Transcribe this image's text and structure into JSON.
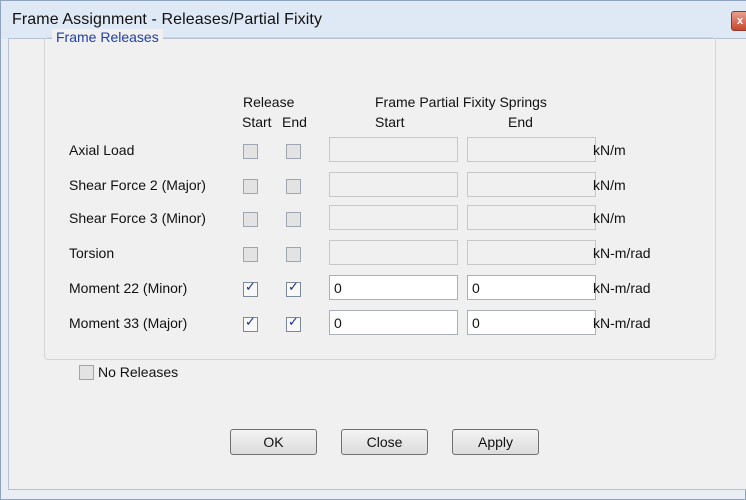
{
  "window": {
    "title": "Frame Assignment - Releases/Partial Fixity",
    "close_glyph": "x"
  },
  "group": {
    "title": "Frame Releases"
  },
  "headers": {
    "release": "Release",
    "release_start": "Start",
    "release_end": "End",
    "springs": "Frame Partial Fixity Springs",
    "springs_start": "Start",
    "springs_end": "End"
  },
  "rows": [
    {
      "label": "Axial Load",
      "start_checked": false,
      "end_checked": false,
      "start_value": "",
      "end_value": "",
      "unit": "kN/m",
      "enabled": false
    },
    {
      "label": "Shear Force 2 (Major)",
      "start_checked": false,
      "end_checked": false,
      "start_value": "",
      "end_value": "",
      "unit": "kN/m",
      "enabled": false
    },
    {
      "label": "Shear Force 3 (Minor)",
      "start_checked": false,
      "end_checked": false,
      "start_value": "",
      "end_value": "",
      "unit": "kN/m",
      "enabled": false
    },
    {
      "label": "Torsion",
      "start_checked": false,
      "end_checked": false,
      "start_value": "",
      "end_value": "",
      "unit": "kN-m/rad",
      "enabled": false
    },
    {
      "label": "Moment 22 (Minor)",
      "start_checked": true,
      "end_checked": true,
      "start_value": "0",
      "end_value": "0",
      "unit": "kN-m/rad",
      "enabled": true
    },
    {
      "label": "Moment 33 (Major)",
      "start_checked": true,
      "end_checked": true,
      "start_value": "0",
      "end_value": "0",
      "unit": "kN-m/rad",
      "enabled": true
    }
  ],
  "no_releases": {
    "label": "No Releases",
    "checked": false
  },
  "buttons": {
    "ok": "OK",
    "close": "Close",
    "apply": "Apply"
  }
}
